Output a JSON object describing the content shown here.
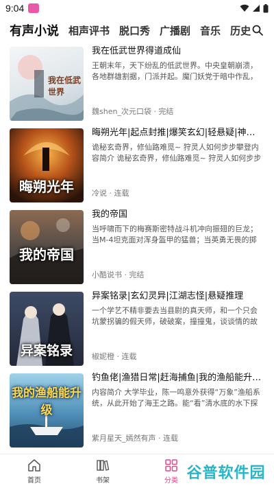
{
  "status_bar": {
    "time": "9:04"
  },
  "tabs": {
    "items": [
      {
        "label": "有声小说",
        "active": true
      },
      {
        "label": "相声评书",
        "active": false
      },
      {
        "label": "脱口秀",
        "active": false
      },
      {
        "label": "广播剧",
        "active": false
      },
      {
        "label": "音乐",
        "active": false
      },
      {
        "label": "历史",
        "active": false
      }
    ]
  },
  "books": [
    {
      "title": "我在低武世界得道成仙",
      "desc": "王朝末年，天下纷乱的低武世界。中央皇朝崩溃，各地群雄割据，门派并起。魔门妖党于暗中作乱，",
      "meta": "魏shen_次元口袋 · 完结",
      "cover_text": "我在低武世界",
      "cover_color": "#e9edf0"
    },
    {
      "title": "晦朔光年|起点封推|爆笑玄幻|轻悬疑|神作必听",
      "desc": "诡秘玄奇界，修仙路难觅~ 狩灵人如何步步攀登内容简介 诡秘玄奇界，修仙路难觅~ 狩灵人如何步步攀",
      "meta": "冷说 · 连载",
      "cover_text": "晦朔光年",
      "cover_color": "#2a1a10"
    },
    {
      "title": "我的帝国",
      "desc": "当呼啸而下的梅赛斯密特战斗机冲向振翅的巨龙；当M-4坦克面对浑身盔甲的猛兽；当英勇无畏的掷弹兵...",
      "meta": "小酷说书 · 完结",
      "cover_text": "我的帝国",
      "cover_color": "#4a4440"
    },
    {
      "title": "异案铭录|玄幻灵异|江湖志怪|悬疑推理",
      "desc": "一个学艺不精非要去当县尉的真天师，和一个只会坑蒙拐骗的假天师，破破案，撞撞鬼，谈谈情的故事。",
      "meta": "椒妮橙 · 连载",
      "cover_text": "异案铭录",
      "cover_color": "#2b3548"
    },
    {
      "title": "钓鱼佬|渔猎日常|赶海捕鱼|我的渔船能升级|...",
      "desc": "内容简介 大学毕业，陈一鸣意外获得“万象”渔船系统，从此开始了海王之路。能“看”清水底的水下探测...",
      "meta": "紫月星天_嫣然有声 · 连载",
      "cover_text": "我的渔船能升级",
      "cover_color": "#5e8fb5"
    }
  ],
  "bottom_nav": [
    {
      "label": "首页",
      "icon": "home-icon",
      "active": false
    },
    {
      "label": "书架",
      "icon": "bookshelf-icon",
      "active": false
    },
    {
      "label": "分类",
      "icon": "category-icon",
      "active": true
    }
  ],
  "watermark": {
    "text": "谷普软件园"
  },
  "colors": {
    "accent": "#e8458b",
    "watermark": "#29b5c9"
  }
}
